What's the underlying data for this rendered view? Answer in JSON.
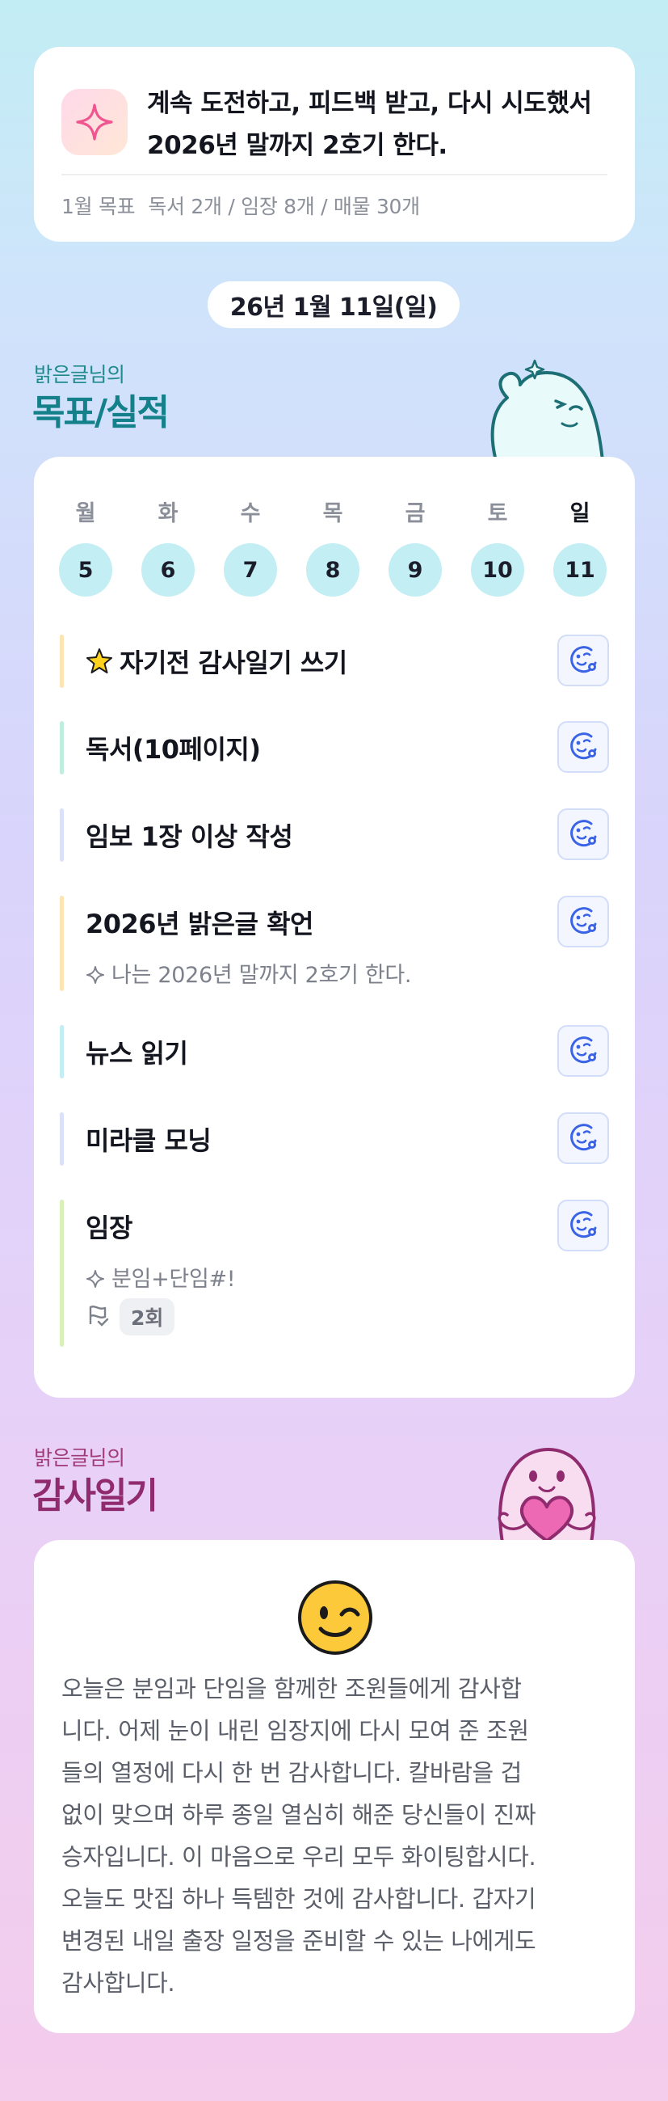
{
  "goal_card": {
    "icon": "sparkle-icon",
    "text": "계속 도전하고, 피드백 받고, 다시 시도했서 2026년 말까지 2호기 한다.",
    "monthly_label": "1월 목표",
    "monthly_goals": "독서 2개 / 임장 8개 / 매물 30개"
  },
  "date_label": "26년 1월 11일(일)",
  "goals_section": {
    "subtitle": "밝은글님의",
    "title": "목표/실적"
  },
  "week": {
    "days": [
      {
        "dow": "월",
        "date": "5"
      },
      {
        "dow": "화",
        "date": "6"
      },
      {
        "dow": "수",
        "date": "7"
      },
      {
        "dow": "목",
        "date": "8"
      },
      {
        "dow": "금",
        "date": "9"
      },
      {
        "dow": "토",
        "date": "10"
      },
      {
        "dow": "일",
        "date": "11"
      }
    ]
  },
  "tasks": [
    {
      "label": "자기전 감사일기 쓰기",
      "star": "🌟",
      "bar_color": "#fde4b4"
    },
    {
      "label": "독서(10페이지)",
      "bar_color": "#bfeede"
    },
    {
      "label": "임보 1장 이상 작성",
      "bar_color": "#dbe1f8"
    },
    {
      "label": "2026년 밝은글 확언",
      "note": "나는 2026년 말까지 2호기 한다.",
      "bar_color": "#fde4b4"
    },
    {
      "label": "뉴스 읽기",
      "bar_color": "#c3eef4"
    },
    {
      "label": "미라클 모닝",
      "bar_color": "#dbe1f8"
    },
    {
      "label": "임장",
      "note": "분임+단임#!",
      "count": "2회",
      "bar_color": "#d9f0b8"
    }
  ],
  "diary_section": {
    "subtitle": "밝은글님의",
    "title": "감사일기"
  },
  "diary": {
    "emoji": "winking-face-icon",
    "lines": [
      "오늘은 분임과 단임을 함께한 조원들에게 감사합",
      "니다. 어제 눈이 내린 임장지에 다시 모여 준 조원",
      "들의 열정에 다시 한 번 감사합니다. 칼바람을 겁",
      "없이 맞으며 하루 종일 열심히 해준 당신들이 진짜",
      "승자입니다. 이 마음으로 우리 모두 화이팅합시다.",
      "오늘도 맛집 하나 득템한 것에 감사합니다. 갑자기",
      "변경된 내일 출장 일정을 준비할 수 있는 나에게도",
      "감사합니다."
    ]
  }
}
